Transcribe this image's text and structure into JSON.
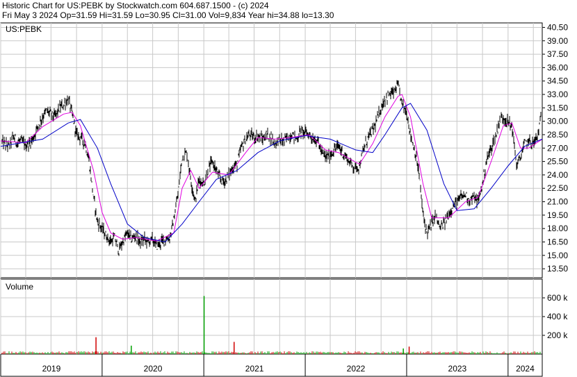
{
  "header": {
    "title": "Historic Chart for US:PEBK by Stockwatch.com 604.687.1500 - (c) 2024",
    "stats": "Fri May  3 2024   Op=31.59   Hi=31.59   Lo=30.95   Cl=31.00   Vol=9,834   Year hi=34.88   lo=13.30"
  },
  "price_panel": {
    "label": "US:PEBK"
  },
  "volume_panel": {
    "label": "Volume"
  },
  "colors": {
    "price": "#000000",
    "ma_short": "#e000e0",
    "ma_long": "#0000c8",
    "volume_up": "#00a000",
    "volume_down": "#d00000",
    "grid": "#c8c8c8"
  },
  "chart_data": [
    {
      "type": "line",
      "title": "US:PEBK",
      "x_axis": {
        "range": [
          "2019-01-01",
          "2024-05-03"
        ],
        "tick_labels": [
          "2019",
          "2020",
          "2021",
          "2022",
          "2023",
          "2024"
        ]
      },
      "y_axis": {
        "range": [
          12.5,
          41.0
        ],
        "tick_labels": [
          "13.50",
          "15.00",
          "16.50",
          "18.00",
          "19.50",
          "21.00",
          "22.50",
          "24.00",
          "25.50",
          "27.00",
          "28.50",
          "30.00",
          "31.50",
          "33.00",
          "34.50",
          "36.00",
          "37.50",
          "39.00",
          "40.50"
        ]
      },
      "grid": true,
      "series": [
        {
          "style": "price-bars",
          "points": [
            [
              "2019-01-01",
              27.8
            ],
            [
              "2019-01-15",
              27.5
            ],
            [
              "2019-02-01",
              27.2
            ],
            [
              "2019-02-15",
              28.3
            ],
            [
              "2019-03-01",
              27.6
            ],
            [
              "2019-03-15",
              27.8
            ],
            [
              "2019-04-01",
              27.3
            ],
            [
              "2019-04-15",
              27.5
            ],
            [
              "2019-05-01",
              28.3
            ],
            [
              "2019-05-15",
              29.5
            ],
            [
              "2019-06-01",
              30.5
            ],
            [
              "2019-06-15",
              31.2
            ],
            [
              "2019-07-01",
              30.8
            ],
            [
              "2019-07-15",
              30.5
            ],
            [
              "2019-08-01",
              31.5
            ],
            [
              "2019-08-15",
              31.8
            ],
            [
              "2019-09-01",
              32.5
            ],
            [
              "2019-09-15",
              30.8
            ],
            [
              "2019-10-01",
              28.5
            ],
            [
              "2019-10-15",
              28.2
            ],
            [
              "2019-11-01",
              27.5
            ],
            [
              "2019-11-15",
              25.5
            ],
            [
              "2019-12-01",
              21.5
            ],
            [
              "2019-12-15",
              18.8
            ],
            [
              "2020-01-01",
              18.0
            ],
            [
              "2020-01-15",
              17.2
            ],
            [
              "2020-02-01",
              16.5
            ],
            [
              "2020-02-15",
              17.0
            ],
            [
              "2020-03-01",
              15.5
            ],
            [
              "2020-03-15",
              16.5
            ],
            [
              "2020-04-01",
              17.5
            ],
            [
              "2020-04-15",
              16.8
            ],
            [
              "2020-05-01",
              17.2
            ],
            [
              "2020-05-15",
              16.5
            ],
            [
              "2020-06-01",
              16.8
            ],
            [
              "2020-06-15",
              16.5
            ],
            [
              "2020-07-01",
              16.8
            ],
            [
              "2020-07-15",
              16.0
            ],
            [
              "2020-08-01",
              16.5
            ],
            [
              "2020-08-15",
              16.8
            ],
            [
              "2020-09-01",
              17.0
            ],
            [
              "2020-09-15",
              19.0
            ],
            [
              "2020-10-01",
              22.0
            ],
            [
              "2020-10-15",
              26.0
            ],
            [
              "2020-11-01",
              26.5
            ],
            [
              "2020-11-15",
              23.5
            ],
            [
              "2020-12-01",
              21.0
            ],
            [
              "2020-12-15",
              23.5
            ],
            [
              "2021-01-01",
              23.0
            ],
            [
              "2021-01-15",
              24.5
            ],
            [
              "2021-02-01",
              25.5
            ],
            [
              "2021-02-15",
              24.5
            ],
            [
              "2021-03-01",
              23.5
            ],
            [
              "2021-03-15",
              23.2
            ],
            [
              "2021-04-01",
              24.0
            ],
            [
              "2021-04-15",
              24.8
            ],
            [
              "2021-05-01",
              25.2
            ],
            [
              "2021-05-15",
              27.0
            ],
            [
              "2021-06-01",
              28.0
            ],
            [
              "2021-06-15",
              28.5
            ],
            [
              "2021-07-01",
              28.2
            ],
            [
              "2021-07-15",
              28.3
            ],
            [
              "2021-08-01",
              28.0
            ],
            [
              "2021-08-15",
              28.5
            ],
            [
              "2021-09-01",
              28.2
            ],
            [
              "2021-09-15",
              27.5
            ],
            [
              "2021-10-01",
              28.0
            ],
            [
              "2021-10-15",
              27.7
            ],
            [
              "2021-11-01",
              28.3
            ],
            [
              "2021-11-15",
              28.5
            ],
            [
              "2021-12-01",
              28.0
            ],
            [
              "2021-12-15",
              28.8
            ],
            [
              "2022-01-01",
              28.8
            ],
            [
              "2022-01-15",
              28.5
            ],
            [
              "2022-02-01",
              28.0
            ],
            [
              "2022-02-15",
              27.8
            ],
            [
              "2022-03-01",
              26.5
            ],
            [
              "2022-03-15",
              26.0
            ],
            [
              "2022-04-01",
              26.2
            ],
            [
              "2022-04-15",
              26.8
            ],
            [
              "2022-05-01",
              27.2
            ],
            [
              "2022-05-15",
              26.5
            ],
            [
              "2022-06-01",
              25.8
            ],
            [
              "2022-06-15",
              25.2
            ],
            [
              "2022-07-01",
              24.8
            ],
            [
              "2022-07-15",
              25.0
            ],
            [
              "2022-08-01",
              27.0
            ],
            [
              "2022-08-15",
              28.2
            ],
            [
              "2022-09-01",
              29.0
            ],
            [
              "2022-09-15",
              30.0
            ],
            [
              "2022-10-01",
              31.5
            ],
            [
              "2022-10-15",
              32.5
            ],
            [
              "2022-11-01",
              33.0
            ],
            [
              "2022-11-15",
              33.2
            ],
            [
              "2022-12-01",
              34.0
            ],
            [
              "2022-12-15",
              32.0
            ],
            [
              "2023-01-01",
              31.0
            ],
            [
              "2023-01-15",
              28.5
            ],
            [
              "2023-02-01",
              26.5
            ],
            [
              "2023-02-15",
              24.0
            ],
            [
              "2023-03-01",
              19.5
            ],
            [
              "2023-03-15",
              17.5
            ],
            [
              "2023-04-01",
              18.5
            ],
            [
              "2023-04-15",
              19.5
            ],
            [
              "2023-05-01",
              18.0
            ],
            [
              "2023-05-15",
              18.5
            ],
            [
              "2023-06-01",
              19.5
            ],
            [
              "2023-06-15",
              20.5
            ],
            [
              "2023-07-01",
              20.8
            ],
            [
              "2023-07-15",
              21.5
            ],
            [
              "2023-08-01",
              21.8
            ],
            [
              "2023-08-15",
              21.2
            ],
            [
              "2023-09-01",
              21.5
            ],
            [
              "2023-09-15",
              21.0
            ],
            [
              "2023-10-01",
              23.0
            ],
            [
              "2023-10-15",
              25.5
            ],
            [
              "2023-11-01",
              27.0
            ],
            [
              "2023-11-15",
              28.0
            ],
            [
              "2023-12-01",
              30.0
            ],
            [
              "2023-12-15",
              30.5
            ],
            [
              "2024-01-01",
              29.8
            ],
            [
              "2024-01-15",
              29.5
            ],
            [
              "2024-02-01",
              25.0
            ],
            [
              "2024-02-15",
              26.0
            ],
            [
              "2024-03-01",
              27.5
            ],
            [
              "2024-03-15",
              27.8
            ],
            [
              "2024-04-01",
              27.5
            ],
            [
              "2024-04-15",
              28.2
            ],
            [
              "2024-05-03",
              31.0
            ]
          ]
        },
        {
          "style": "moving-average-short",
          "points": [
            [
              "2019-01-01",
              27.8
            ],
            [
              "2019-04-01",
              27.6
            ],
            [
              "2019-06-01",
              29.4
            ],
            [
              "2019-08-15",
              30.8
            ],
            [
              "2019-09-15",
              31.0
            ],
            [
              "2019-10-15",
              29.5
            ],
            [
              "2019-12-01",
              24.5
            ],
            [
              "2020-01-01",
              19.8
            ],
            [
              "2020-02-01",
              17.5
            ],
            [
              "2020-03-15",
              16.8
            ],
            [
              "2020-05-01",
              17.0
            ],
            [
              "2020-07-15",
              16.6
            ],
            [
              "2020-09-15",
              17.5
            ],
            [
              "2020-10-15",
              22.5
            ],
            [
              "2020-11-15",
              24.5
            ],
            [
              "2020-12-15",
              22.5
            ],
            [
              "2021-02-01",
              24.3
            ],
            [
              "2021-04-01",
              24.0
            ],
            [
              "2021-06-01",
              26.5
            ],
            [
              "2021-07-15",
              28.2
            ],
            [
              "2021-09-15",
              28.0
            ],
            [
              "2021-11-15",
              28.2
            ],
            [
              "2022-01-15",
              28.5
            ],
            [
              "2022-03-15",
              26.8
            ],
            [
              "2022-05-01",
              26.5
            ],
            [
              "2022-07-15",
              25.2
            ],
            [
              "2022-09-01",
              27.5
            ],
            [
              "2022-10-15",
              30.5
            ],
            [
              "2022-12-01",
              32.8
            ],
            [
              "2022-12-15",
              33.0
            ],
            [
              "2023-01-15",
              30.5
            ],
            [
              "2023-03-01",
              23.0
            ],
            [
              "2023-04-01",
              19.2
            ],
            [
              "2023-06-01",
              19.2
            ],
            [
              "2023-08-01",
              21.0
            ],
            [
              "2023-09-15",
              21.5
            ],
            [
              "2023-11-01",
              25.5
            ],
            [
              "2023-12-15",
              29.5
            ],
            [
              "2024-01-15",
              29.8
            ],
            [
              "2024-02-15",
              27.0
            ],
            [
              "2024-03-15",
              27.0
            ],
            [
              "2024-05-03",
              28.0
            ]
          ]
        },
        {
          "style": "moving-average-long",
          "points": [
            [
              "2019-01-01",
              27.2
            ],
            [
              "2019-06-01",
              28.0
            ],
            [
              "2019-09-01",
              29.8
            ],
            [
              "2019-10-15",
              30.2
            ],
            [
              "2019-12-15",
              27.0
            ],
            [
              "2020-02-01",
              23.0
            ],
            [
              "2020-04-01",
              18.5
            ],
            [
              "2020-06-01",
              17.0
            ],
            [
              "2020-08-15",
              16.5
            ],
            [
              "2020-10-15",
              18.5
            ],
            [
              "2020-12-15",
              21.0
            ],
            [
              "2021-02-15",
              23.5
            ],
            [
              "2021-05-01",
              24.5
            ],
            [
              "2021-07-15",
              26.5
            ],
            [
              "2021-10-01",
              27.8
            ],
            [
              "2022-01-01",
              28.4
            ],
            [
              "2022-04-01",
              28.0
            ],
            [
              "2022-07-01",
              26.8
            ],
            [
              "2022-09-01",
              26.5
            ],
            [
              "2022-10-15",
              28.5
            ],
            [
              "2022-12-15",
              31.5
            ],
            [
              "2023-01-15",
              32.0
            ],
            [
              "2023-03-15",
              29.0
            ],
            [
              "2023-05-15",
              23.0
            ],
            [
              "2023-07-01",
              20.0
            ],
            [
              "2023-09-01",
              20.2
            ],
            [
              "2023-11-01",
              22.5
            ],
            [
              "2024-01-01",
              25.0
            ],
            [
              "2024-03-01",
              27.2
            ],
            [
              "2024-05-03",
              28.0
            ]
          ]
        }
      ]
    },
    {
      "type": "bar",
      "title": "Volume",
      "y_axis": {
        "range": [
          0,
          800000
        ],
        "tick_labels": [
          "200 k",
          "400 k",
          "600 k"
        ]
      },
      "series": [
        {
          "style": "volume-spikes",
          "points": [
            [
              "2019-12-10",
              180000,
              "down"
            ],
            [
              "2021-01-02",
              620000,
              "up"
            ],
            [
              "2021-04-20",
              130000,
              "down"
            ],
            [
              "2020-04-15",
              90000,
              "up"
            ],
            [
              "2023-01-10",
              80000,
              "down"
            ],
            [
              "2022-12-20",
              60000,
              "up"
            ]
          ]
        }
      ]
    }
  ]
}
